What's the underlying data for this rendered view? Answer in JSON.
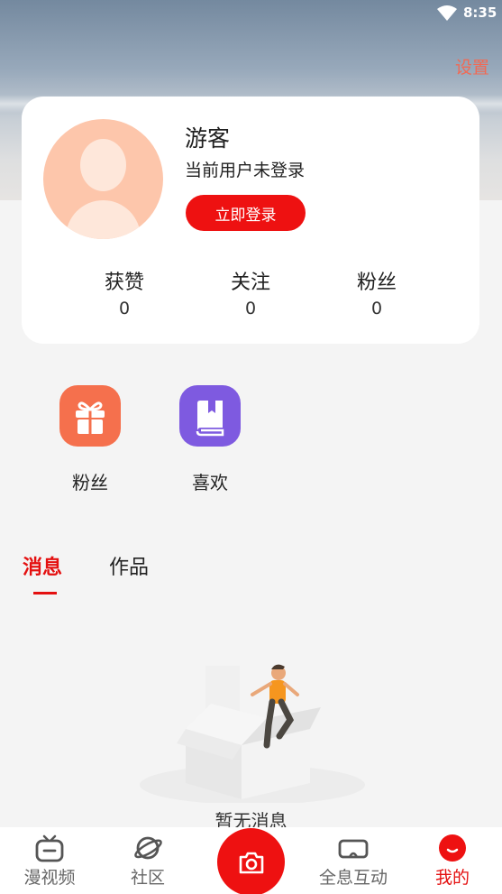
{
  "status_bar": {
    "time": "8:35"
  },
  "header": {
    "settings_label": "设置"
  },
  "profile": {
    "name": "游客",
    "status": "当前用户未登录",
    "login_button": "立即登录",
    "stats": [
      {
        "label": "获赞",
        "value": "0"
      },
      {
        "label": "关注",
        "value": "0"
      },
      {
        "label": "粉丝",
        "value": "0"
      }
    ]
  },
  "features": [
    {
      "label": "粉丝",
      "icon": "gift-icon",
      "color": "#f5704d"
    },
    {
      "label": "喜欢",
      "icon": "book-icon",
      "color": "#7e5ae0"
    }
  ],
  "tabs": [
    {
      "label": "消息",
      "active": true
    },
    {
      "label": "作品",
      "active": false
    }
  ],
  "empty_state": {
    "text": "暂无消息"
  },
  "bottom_nav": [
    {
      "label": "漫视频",
      "icon": "tv-icon"
    },
    {
      "label": "社区",
      "icon": "planet-icon"
    },
    {
      "label": "",
      "icon": "camera-icon"
    },
    {
      "label": "全息互动",
      "icon": "vr-headset-icon"
    },
    {
      "label": "我的",
      "icon": "smile-icon",
      "active": true
    }
  ],
  "colors": {
    "accent": "#ee1111",
    "settings": "#f06a55",
    "avatar": "#fdc6ab"
  }
}
